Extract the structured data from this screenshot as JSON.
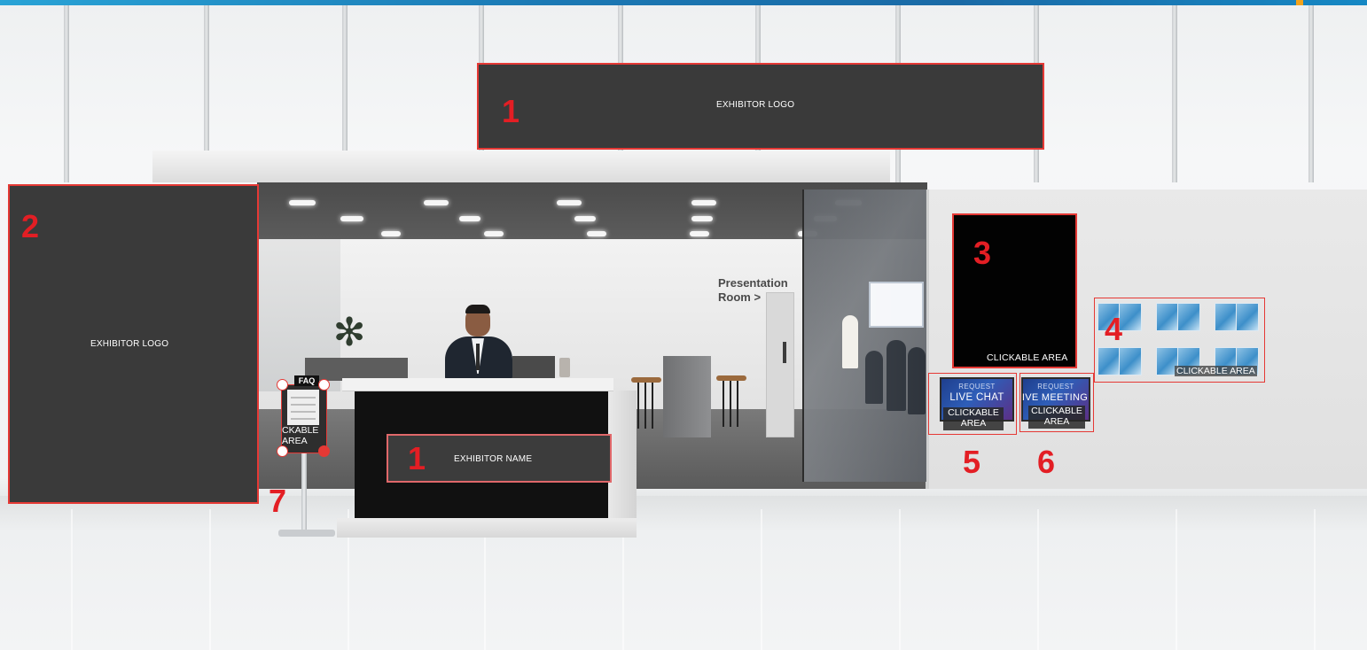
{
  "booth": {
    "top_logo": {
      "label": "EXHIBITOR LOGO",
      "marker": "1"
    },
    "side_logo": {
      "label": "EXHIBITOR LOGO",
      "marker": "2"
    },
    "poster": {
      "label": "CLICKABLE AREA",
      "marker": "3"
    },
    "brochures": {
      "label": "CLICKABLE AREA",
      "marker": "4"
    },
    "live_chat": {
      "small": "REQUEST",
      "big": "LIVE CHAT",
      "label": "CLICKABLE AREA",
      "marker": "5"
    },
    "live_meeting": {
      "small": "REQUEST",
      "big": "IVE MEETING",
      "label": "CLICKABLE AREA",
      "marker": "6"
    },
    "faq": {
      "tag": "FAQ",
      "label": "CKABLE AREA",
      "marker": "7"
    },
    "desk_name": {
      "label": "EXHIBITOR NAME",
      "marker": "1"
    },
    "presentation_room": {
      "label": "Presentation Room >"
    }
  },
  "colors": {
    "marker": "#e31e24",
    "panel": "#3a3a3a",
    "highlight_border": "#e53935",
    "top_bar": "#1b79b4"
  }
}
